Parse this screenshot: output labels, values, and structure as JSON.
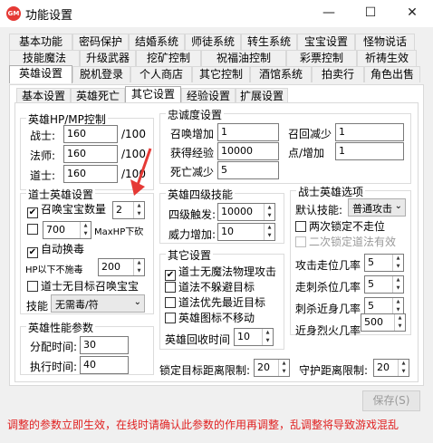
{
  "window": {
    "title": "功能设置",
    "icon_text": "GM",
    "minimize": "—",
    "maximize": "☐",
    "close": "✕"
  },
  "tabs_row1": [
    "基本功能",
    "密码保护",
    "结婚系统",
    "师徒系统",
    "转生系统",
    "宝宝设置",
    "怪物说话"
  ],
  "tabs_row2": [
    "技能魔法",
    "升级武器",
    "挖矿控制",
    "祝福油控制",
    "彩票控制",
    "祈祷生效"
  ],
  "tabs_row3": [
    "英雄设置",
    "脱机登录",
    "个人商店",
    "其它控制",
    "酒馆系统",
    "拍卖行",
    "角色出售"
  ],
  "subtabs": [
    "基本设置",
    "英雄死亡",
    "其它设置",
    "经验设置",
    "扩展设置"
  ],
  "hp_mp": {
    "title": "英雄HP/MP控制",
    "rows": [
      {
        "label": "战士:",
        "value": "160",
        "unit": "/100"
      },
      {
        "label": "法师:",
        "value": "160",
        "unit": "/100"
      },
      {
        "label": "道士:",
        "value": "160",
        "unit": "/100"
      }
    ]
  },
  "loyalty": {
    "title": "忠诚度设置",
    "rows": [
      {
        "label": "召唤增加",
        "value": "1"
      },
      {
        "label": "获得经验",
        "value": "10000"
      },
      {
        "label": "死亡减少",
        "value": "5"
      }
    ],
    "rows_right": [
      {
        "label": "召回减少",
        "value": "1"
      },
      {
        "label": "点/增加",
        "value": "1"
      }
    ]
  },
  "taoist": {
    "title": "道士英雄设置",
    "summon_label": "召唤宝宝数量",
    "summon_value": "2",
    "mp_value": "700",
    "mp_label": "MaxHP下砍",
    "auto_poison": "自动换毒",
    "hp_no_poison_label": "HP以下不施毒",
    "hp_no_poison_value": "200",
    "no_target_summon": "道士无目标召唤宝宝",
    "skill_label": "技能",
    "skill_value": "无需毒/符"
  },
  "perf": {
    "title": "英雄性能参数",
    "rows": [
      {
        "label": "分配时间:",
        "value": "30"
      },
      {
        "label": "执行时间:",
        "value": "40"
      }
    ]
  },
  "level4": {
    "title": "英雄四级技能",
    "rows": [
      {
        "label": "四级触发:",
        "value": "10000"
      },
      {
        "label": "威力增加:",
        "value": "10"
      }
    ]
  },
  "other": {
    "title": "其它设置",
    "checks": [
      {
        "label": "道士无魔法物理攻击",
        "checked": true
      },
      {
        "label": "道法不躲避目标",
        "checked": false
      },
      {
        "label": "道法优先最近目标",
        "checked": false
      },
      {
        "label": "英雄图标不移动",
        "checked": false
      }
    ],
    "recall_label": "英雄回收时间",
    "recall_value": "10"
  },
  "warrior": {
    "title": "战士英雄选项",
    "default_skill_label": "默认技能:",
    "default_skill_value": "普通攻击",
    "checks": [
      {
        "label": "两次锁定不走位",
        "checked": false,
        "disabled": false
      },
      {
        "label": "二次锁定道法有效",
        "checked": false,
        "disabled": true
      }
    ],
    "rates": [
      {
        "label": "攻击走位几率",
        "value": "5"
      },
      {
        "label": "走刺杀位几率",
        "value": "5"
      },
      {
        "label": "刺杀近身几率",
        "value": "5"
      },
      {
        "label": "近身烈火几率",
        "value": "500"
      }
    ]
  },
  "lock_distance": {
    "label": "锁定目标距离限制:",
    "value": "20"
  },
  "guard_distance": {
    "label": "守护距离限制:",
    "value": "20"
  },
  "save_label": "保存(S)",
  "footer": "调整的参数立即生效，在线时请确认此参数的作用再调整，乱调整将导致游戏混乱",
  "colors": {
    "footer": "#e02020",
    "arrow": "#e53935",
    "accent": "#0078d7"
  }
}
